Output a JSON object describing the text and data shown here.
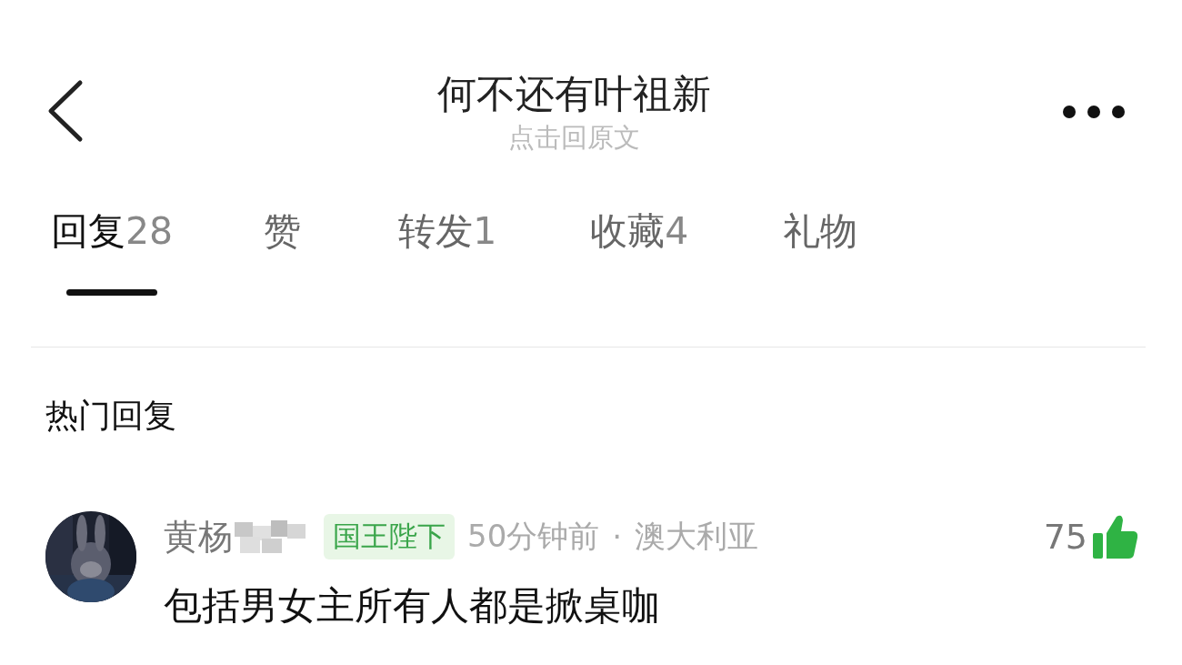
{
  "header": {
    "title": "何不还有叶祖新",
    "subtitle": "点击回原文"
  },
  "tabs": [
    {
      "label": "回复",
      "count": "28",
      "selected": true
    },
    {
      "label": "赞",
      "selected": false
    },
    {
      "label": "转发",
      "count": "1",
      "selected": false
    },
    {
      "label": "收藏",
      "count": "4",
      "selected": false
    },
    {
      "label": "礼物",
      "selected": false
    }
  ],
  "section_title": "热门回复",
  "comments": [
    {
      "username": "黄杨",
      "username_blurred": true,
      "badge": "国王陛下",
      "time": "50分钟前",
      "separator": "·",
      "location": "澳大利亚",
      "likes": "75",
      "text": "包括男女主所有人都是掀桌咖"
    }
  ]
}
